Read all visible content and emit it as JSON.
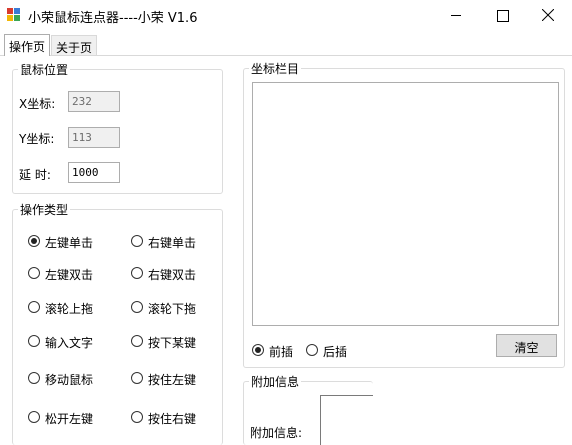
{
  "window": {
    "title": "小荣鼠标连点器----小荣 V1.6",
    "icon": "app-icon"
  },
  "tabs": [
    {
      "label": "操作页",
      "selected": true
    },
    {
      "label": "关于页",
      "selected": false
    }
  ],
  "mouse_position": {
    "title": "鼠标位置",
    "x_label": "X坐标:",
    "x_value": "232",
    "y_label": "Y坐标:",
    "y_value": "113",
    "delay_label": "延 时:",
    "delay_value": "1000"
  },
  "operation_type": {
    "title": "操作类型",
    "options": [
      {
        "label": "左键单击",
        "checked": true
      },
      {
        "label": "右键单击",
        "checked": false
      },
      {
        "label": "左键双击",
        "checked": false
      },
      {
        "label": "右键双击",
        "checked": false
      },
      {
        "label": "滚轮上拖",
        "checked": false
      },
      {
        "label": "滚轮下拖",
        "checked": false
      },
      {
        "label": "输入文字",
        "checked": false
      },
      {
        "label": "按下某键",
        "checked": false
      },
      {
        "label": "移动鼠标",
        "checked": false
      },
      {
        "label": "按住左键",
        "checked": false
      },
      {
        "label": "松开左键",
        "checked": false
      },
      {
        "label": "按住右键",
        "checked": false
      }
    ]
  },
  "coords_panel": {
    "title": "坐标栏目",
    "insert_front": "前插",
    "insert_back": "后插",
    "insert_mode": "前插",
    "clear_button": "清空"
  },
  "extra_info": {
    "title": "附加信息",
    "field_label": "附加信息:"
  },
  "colors": {
    "border": "#dcdcdc",
    "readonly_bg": "#f0f0f0",
    "button_bg": "#e1e1e1"
  }
}
